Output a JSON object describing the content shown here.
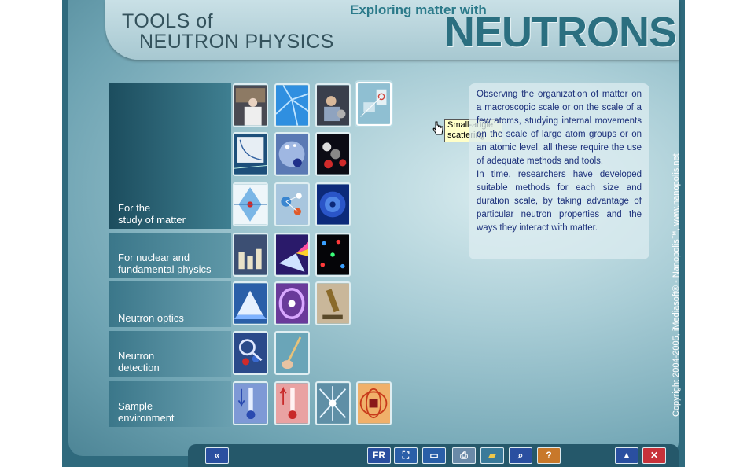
{
  "header": {
    "title_line1": "TOOLS of",
    "title_line2": "NEUTRON PHYSICS",
    "subtitle": "Exploring matter with",
    "brand": "NEUTRONS"
  },
  "categories": [
    {
      "label": "For the\nstudy of matter"
    },
    {
      "label": "For nuclear and\nfundamental physics"
    },
    {
      "label": "Neutron optics"
    },
    {
      "label": "Neutron\ndetection"
    },
    {
      "label": "Sample\nenvironment"
    }
  ],
  "tooltip": "Small-angle scattering",
  "description": {
    "p1": "Observing the organization of matter on a macroscopic scale or on the scale of a few atoms, studying internal movements on the scale of large atom groups or on an atomic level, all these require the use of adequate methods and tools.",
    "p2": "In time, researchers have developed suitable methods for each size and duration scale, by taking advantage of particular neutron properties and the ways they interact with matter."
  },
  "copyright": "Copyright 2004-2005, iMediasoft® - Nanopolis™, www.nanopolis.net",
  "toolbar": {
    "back_icon": "double-left-arrow-icon",
    "lang_label": "FR",
    "icons": [
      "fullscreen-icon",
      "window-icon",
      "print-icon",
      "folder-icon",
      "zoom-icon",
      "help-icon"
    ],
    "up_icon": "up-arrow-icon",
    "close_icon": "close-icon"
  },
  "colors": {
    "accent": "#2b6f80",
    "text_blue": "#1b2f7a",
    "close_red": "#c8323a"
  }
}
